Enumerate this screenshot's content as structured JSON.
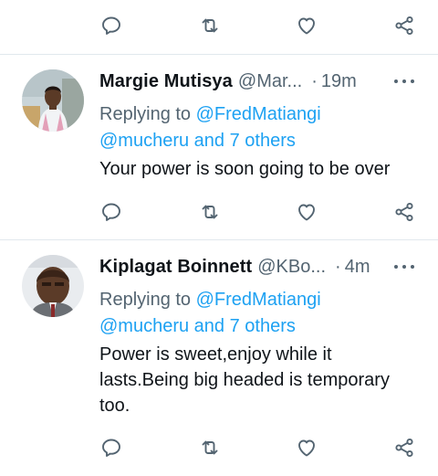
{
  "icons": {
    "reply": "reply-icon",
    "retweet": "retweet-icon",
    "like": "heart-icon",
    "share": "share-icon",
    "more": "more-dots-icon"
  },
  "colors": {
    "link": "#1da1f2",
    "secondary_text": "#536471",
    "divider": "#e1e8ed"
  },
  "tweets": [
    {
      "name": "Margie Mutisya",
      "handle": "@Mar...",
      "dot": "·",
      "time": "19m",
      "replying_prefix": "Replying to",
      "replying_to": "@FredMatiangi",
      "replying_others": "@mucheru and 7 others",
      "text": "Your power is soon going to be over"
    },
    {
      "name": "Kiplagat Boinnett",
      "handle": "@KBo...",
      "dot": "·",
      "time": "4m",
      "replying_prefix": "Replying to",
      "replying_to": "@FredMatiangi",
      "replying_others": "@mucheru and 7 others",
      "text": "Power is sweet,enjoy while it lasts.Being big headed is temporary too."
    }
  ]
}
